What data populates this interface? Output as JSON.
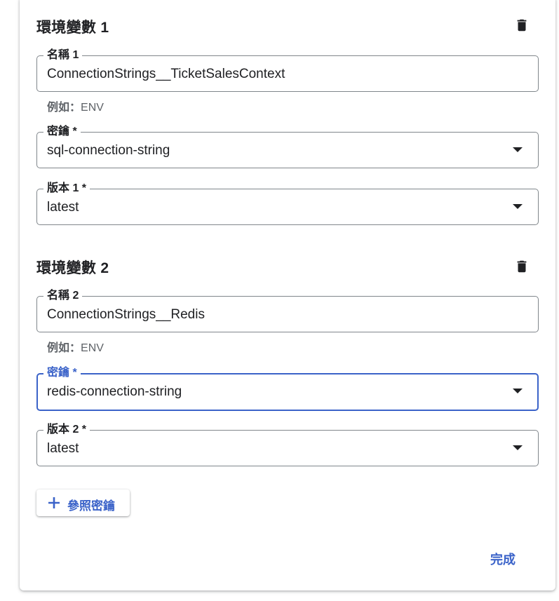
{
  "colors": {
    "accent": "#3b63c9",
    "border": "#80868b",
    "text": "#202124",
    "hint": "#5f6368"
  },
  "sections": [
    {
      "title": "環境變數 1",
      "name_label": "名稱 1",
      "name_value": "ConnectionStrings__TicketSalesContext",
      "hint_prefix": "例如：",
      "hint_value": "ENV",
      "secret_label": "密鑰 *",
      "secret_value": "sql-connection-string",
      "version_label": "版本 1 *",
      "version_value": "latest"
    },
    {
      "title": "環境變數 2",
      "name_label": "名稱 2",
      "name_value": "ConnectionStrings__Redis",
      "hint_prefix": "例如：",
      "hint_value": "ENV",
      "secret_label": "密鑰 *",
      "secret_value": "redis-connection-string",
      "version_label": "版本 2 *",
      "version_value": "latest"
    }
  ],
  "icons": {
    "delete": "trash-icon",
    "add": "plus-icon",
    "dropdown": "arrow-drop-down-icon"
  },
  "add_secret_label": "參照密鑰",
  "done_label": "完成"
}
